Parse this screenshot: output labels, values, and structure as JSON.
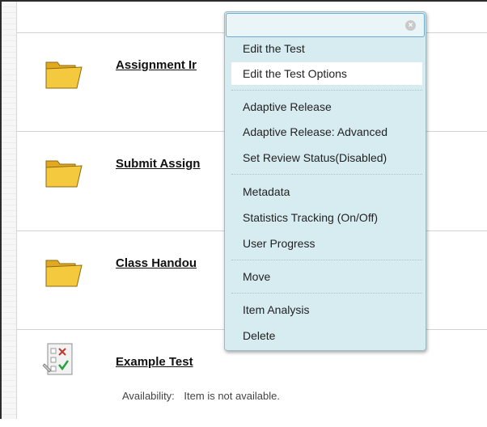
{
  "items": [
    {
      "title": "Assignment Ir",
      "icon": "folder-icon"
    },
    {
      "title": "Submit Assign",
      "icon": "folder-icon"
    },
    {
      "title": "Class Handou",
      "icon": "folder-icon"
    },
    {
      "title": "Example Test",
      "icon": "test-icon",
      "availability_label": "Availability:",
      "availability_value": "Item is not available."
    }
  ],
  "menu": {
    "close_glyph": "×",
    "groups": [
      [
        "Edit the Test",
        "Edit the Test Options"
      ],
      [
        "Adaptive Release",
        "Adaptive Release: Advanced",
        "Set Review Status(Disabled)"
      ],
      [
        "Metadata",
        "Statistics Tracking (On/Off)",
        "User Progress"
      ],
      [
        "Move"
      ],
      [
        "Item Analysis",
        "Delete"
      ]
    ],
    "active_item": "Edit the Test Options"
  },
  "colors": {
    "menu_bg": "#d7ecf0",
    "menu_border": "#9fbac1",
    "header_border": "#6ba9d6",
    "folder": "#f5c93d",
    "active_item_bg": "#ffffff"
  }
}
